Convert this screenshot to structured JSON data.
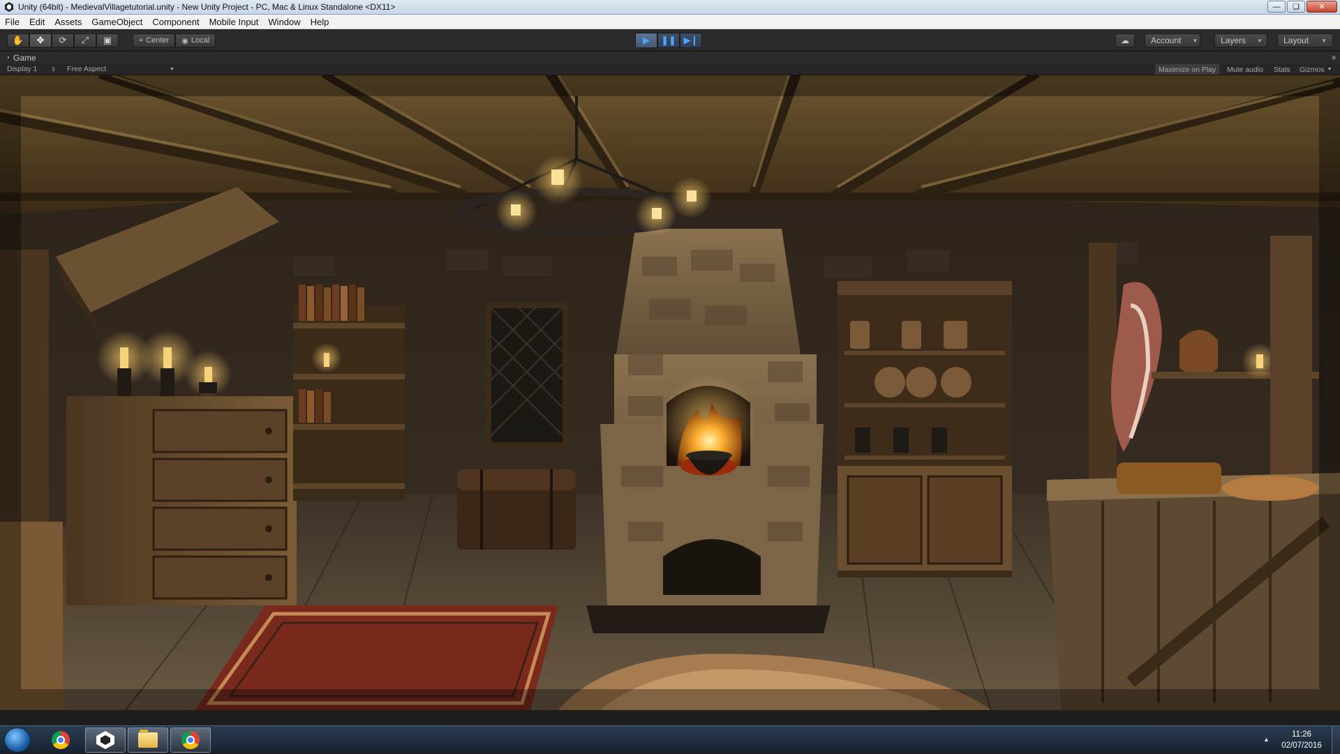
{
  "window": {
    "title": "Unity (64bit) - MedievalVillagetutorial.unity - New Unity Project - PC, Mac & Linux Standalone <DX11>",
    "controls": [
      "minimize",
      "restore",
      "close"
    ]
  },
  "menu": [
    "File",
    "Edit",
    "Assets",
    "GameObject",
    "Component",
    "Mobile Input",
    "Window",
    "Help"
  ],
  "toolbar": {
    "transform_tools": [
      "hand-icon",
      "move-icon",
      "rotate-icon",
      "scale-icon",
      "rect-icon"
    ],
    "pivot": {
      "center_label": "Center",
      "local_label": "Local"
    },
    "play_controls": [
      "play-icon",
      "pause-icon",
      "step-icon"
    ],
    "play_state": "playing",
    "account_label": "Account",
    "layers_label": "Layers",
    "layout_label": "Layout"
  },
  "game_view": {
    "tab_label": "Game",
    "display_label": "Display 1",
    "aspect_label": "Free Aspect",
    "maximize_label": "Maximize on Play",
    "mute_label": "Mute audio",
    "stats_label": "Stats",
    "gizmos_label": "Gizmos"
  },
  "taskbar": {
    "apps": [
      "Chrome",
      "Unity",
      "Windows Explorer",
      "Chrome"
    ],
    "time": "11:26",
    "date": "02/07/2016"
  },
  "colors": {
    "toolbar_bg": "#2b2b2b",
    "play_accent": "#4ea3ff",
    "taskbar_bg": "#1f2f42"
  }
}
